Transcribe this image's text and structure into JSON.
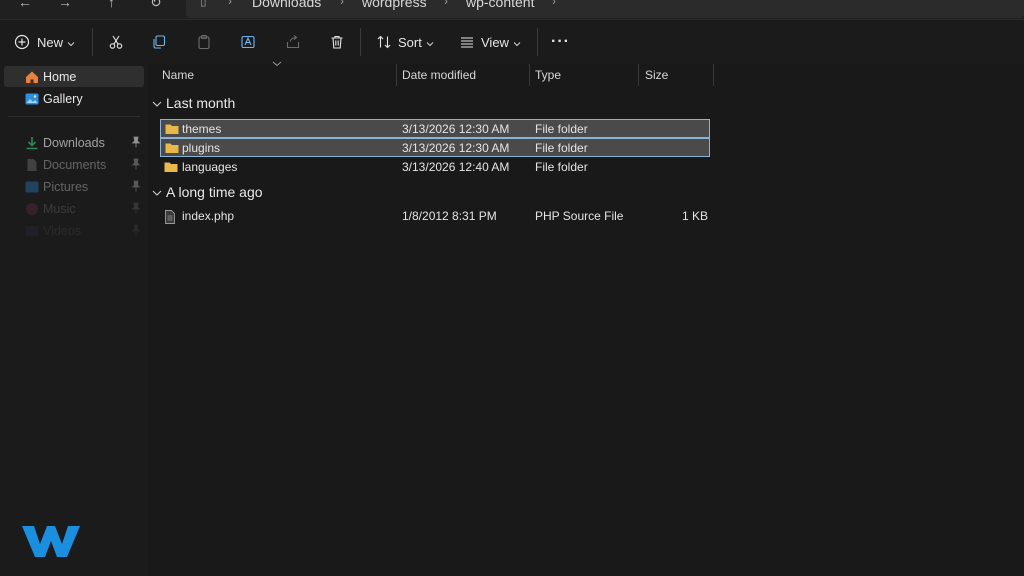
{
  "address": {
    "breadcrumbs": [
      "Downloads",
      "wordpress",
      "wp-content"
    ]
  },
  "toolbar": {
    "new_label": "New",
    "sort_label": "Sort",
    "view_label": "View",
    "more_label": "···"
  },
  "sidebar": {
    "items": [
      {
        "label": "Home",
        "icon": "home-icon",
        "active": true
      },
      {
        "label": "Gallery",
        "icon": "gallery-icon"
      },
      {
        "label": "Downloads",
        "icon": "download-icon",
        "pinned": true
      },
      {
        "label": "Documents",
        "icon": "documents-icon",
        "pinned": true
      },
      {
        "label": "Pictures",
        "icon": "pictures-icon",
        "pinned": true
      },
      {
        "label": "Music",
        "icon": "music-icon",
        "pinned": true
      },
      {
        "label": "Videos",
        "icon": "videos-icon",
        "pinned": true
      }
    ]
  },
  "columns": {
    "name": "Name",
    "date": "Date modified",
    "type": "Type",
    "size": "Size"
  },
  "groups": [
    {
      "title": "Last month",
      "items": [
        {
          "name": "themes",
          "date": "3/13/2026 12:30 AM",
          "type": "File folder",
          "size": "",
          "selected": true
        },
        {
          "name": "plugins",
          "date": "3/13/2026 12:30 AM",
          "type": "File folder",
          "size": "",
          "selected": true
        },
        {
          "name": "languages",
          "date": "3/13/2026 12:40 AM",
          "type": "File folder",
          "size": ""
        }
      ]
    },
    {
      "title": "A long time ago",
      "items": [
        {
          "name": "index.php",
          "date": "1/8/2012 8:31 PM",
          "type": "PHP Source File",
          "size": "1 KB"
        }
      ]
    }
  ],
  "colors": {
    "background": "#191919",
    "selection": "#4a4a4a",
    "selection_border": "#8ab4d6",
    "folder": "#e8b84a",
    "logo_blue": "#1a8fe0"
  }
}
